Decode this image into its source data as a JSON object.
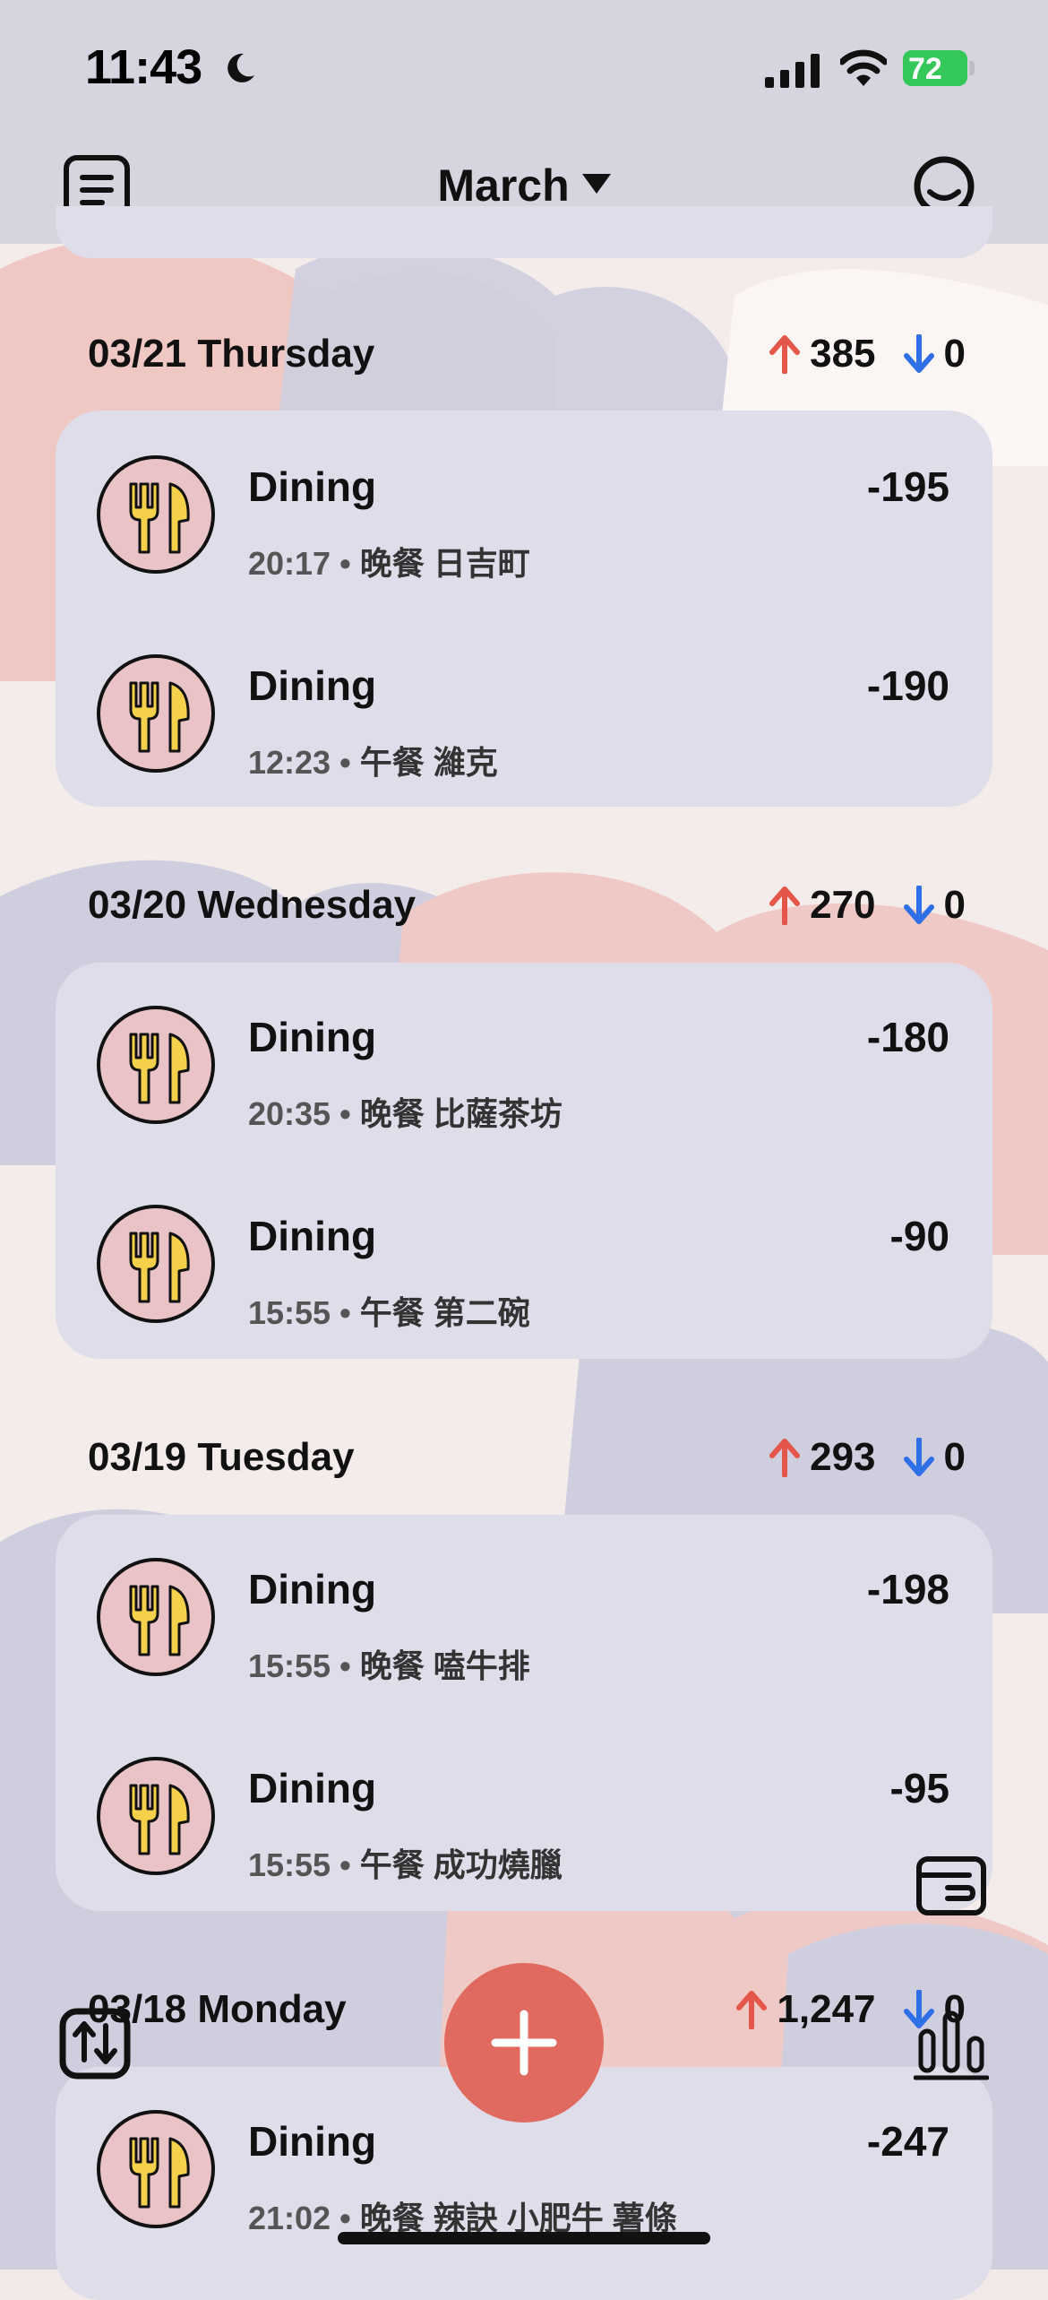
{
  "status_bar": {
    "time": "11:43",
    "battery": "72"
  },
  "nav": {
    "month": "March"
  },
  "days": [
    {
      "date": "03/21 Thursday",
      "expense_total": "385",
      "income_total": "0",
      "items": [
        {
          "category": "Dining",
          "time": "20:17",
          "note": "晚餐 日吉町",
          "amount": "-195"
        },
        {
          "category": "Dining",
          "time": "12:23",
          "note": "午餐 濰克",
          "amount": "-190"
        }
      ]
    },
    {
      "date": "03/20 Wednesday",
      "expense_total": "270",
      "income_total": "0",
      "items": [
        {
          "category": "Dining",
          "time": "20:35",
          "note": "晚餐 比薩茶坊",
          "amount": "-180"
        },
        {
          "category": "Dining",
          "time": "15:55",
          "note": "午餐 第二碗",
          "amount": "-90"
        }
      ]
    },
    {
      "date": "03/19 Tuesday",
      "expense_total": "293",
      "income_total": "0",
      "items": [
        {
          "category": "Dining",
          "time": "15:55",
          "note": "晚餐 嗑牛排",
          "amount": "-198"
        },
        {
          "category": "Dining",
          "time": "15:55",
          "note": "午餐 成功燒臘",
          "amount": "-95"
        }
      ]
    },
    {
      "date": "03/18 Monday",
      "expense_total": "1,247",
      "income_total": "0",
      "items": [
        {
          "category": "Dining",
          "time": "21:02",
          "note": "晚餐 辣訣 小肥牛 薯條",
          "amount": "-247"
        }
      ]
    }
  ],
  "colors": {
    "expense_arrow": "#e5564a",
    "income_arrow": "#2f6fe8",
    "fab": "#e16a60",
    "icon_bg": "#e9c3c6",
    "fork_fill": "#f5d04a"
  },
  "icons": [
    "menu-icon",
    "search-icon",
    "dining-icon",
    "plus-icon",
    "wallet-icon",
    "stats-icon",
    "sort-icon",
    "arrow-up-icon",
    "arrow-down-icon"
  ]
}
